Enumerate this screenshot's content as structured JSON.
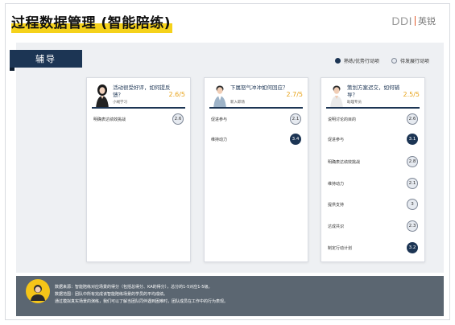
{
  "header": {
    "title": "过程数据管理 (智能陪练)",
    "logo_ddi": "DDI",
    "logo_cn": "英锐"
  },
  "section": {
    "tab_label": "辅导"
  },
  "legend": {
    "filled_label": "熟练/优势行动项",
    "hollow_label": "待发展行动项"
  },
  "cards": [
    {
      "question": "活动很受好评，如何提反馈？",
      "sub": "小绒学习",
      "score": "2.6/5",
      "rows": [
        {
          "label": "明确表达绩效挑战",
          "value": "2.6",
          "style": "light"
        }
      ]
    },
    {
      "question": "下属怒气冲冲如何回应？",
      "sub": "新入职场",
      "score": "2.7/5",
      "rows": [
        {
          "label": "促进参与",
          "value": "2.1",
          "style": "light"
        },
        {
          "label": "维持动力",
          "value": "3.4",
          "style": "dark"
        }
      ]
    },
    {
      "question": "策划方案迟交，如何辅导？",
      "sub": "助理专员",
      "score": "2.5/5",
      "rows": [
        {
          "label": "说明讨论的目的",
          "value": "2.6",
          "style": "light"
        },
        {
          "label": "促进参与",
          "value": "3.1",
          "style": "dark"
        },
        {
          "label": "明确表达绩效挑战",
          "value": "2.8",
          "style": "light"
        },
        {
          "label": "维持动力",
          "value": "2.1",
          "style": "light"
        },
        {
          "label": "提供支持",
          "value": "3",
          "style": "light"
        },
        {
          "label": "达成共识",
          "value": "2.3",
          "style": "light"
        },
        {
          "label": "制定行动计划",
          "value": "3.2",
          "style": "dark"
        }
      ]
    }
  ],
  "footer": {
    "lines": [
      "数据来源：智能陪练对应场景的得分（包括总得分、KA的得分），总分的1-5对应1-5级。",
      "数据范围：团队中所有完成该智能陪练场景的学员的平均成绩。",
      "通过模拟真实场景的演练，我们可以了解当团队同伴遇到困难时，团队成员在工作中的行为表现。"
    ]
  }
}
